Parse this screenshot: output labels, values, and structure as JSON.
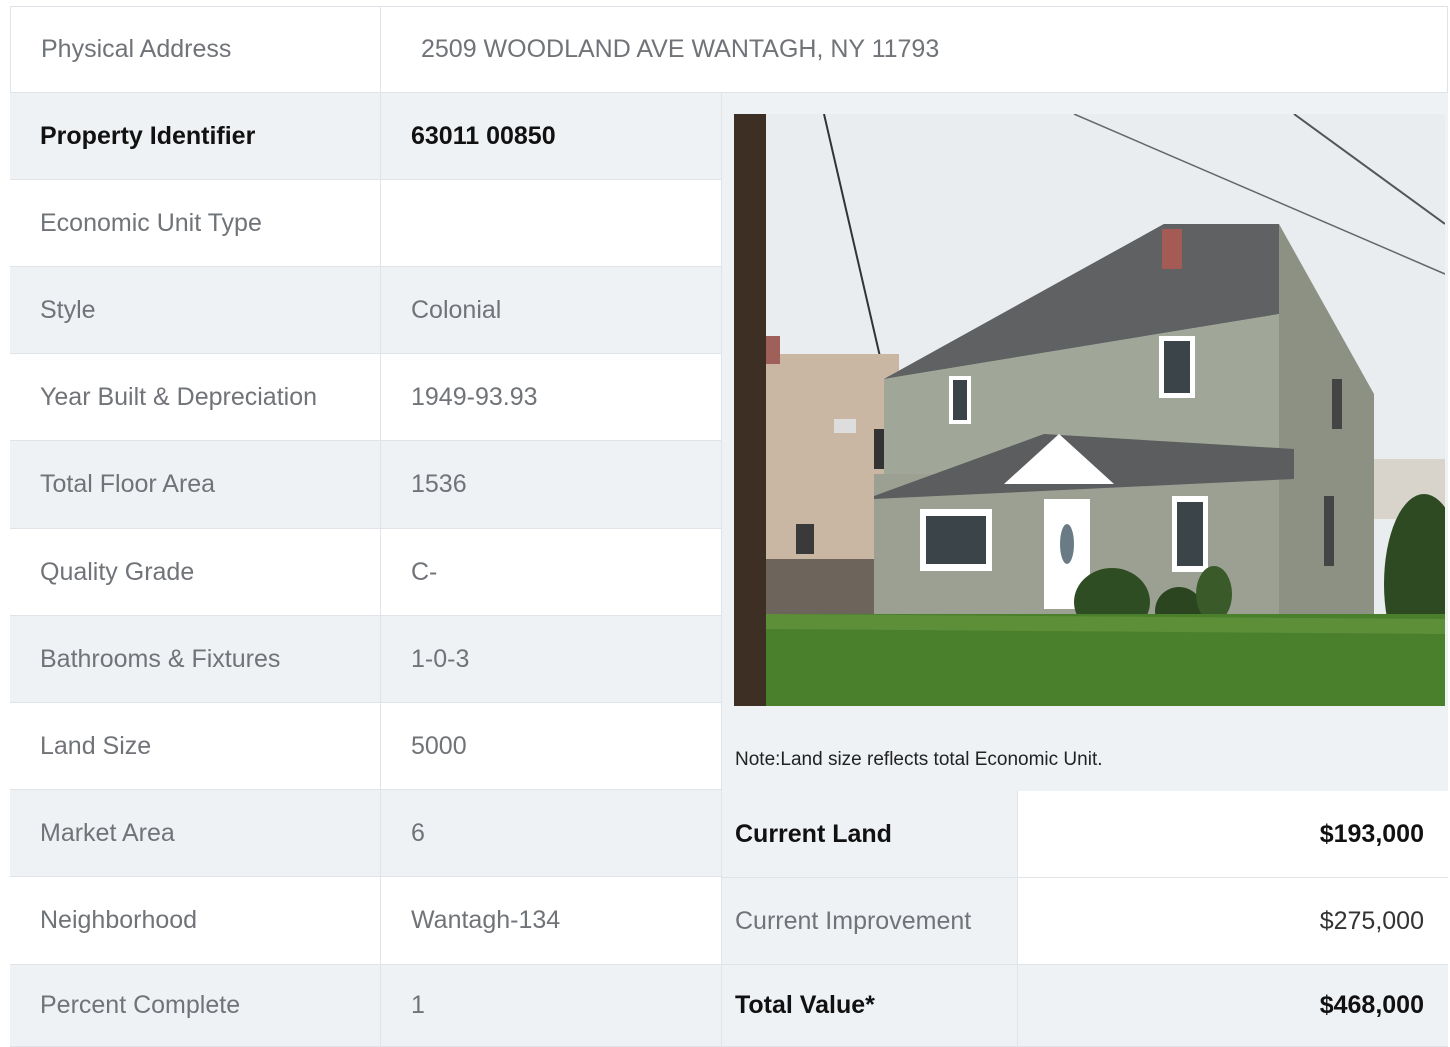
{
  "address": {
    "label": "Physical Address",
    "value": "2509  WOODLAND AVE  WANTAGH, NY  11793"
  },
  "rows": [
    {
      "label": "Property Identifier",
      "value": "63011  00850"
    },
    {
      "label": "Economic Unit Type",
      "value": ""
    },
    {
      "label": "Style",
      "value": "Colonial"
    },
    {
      "label": "Year Built & Depreciation",
      "value": "1949-93.93"
    },
    {
      "label": "Total Floor Area",
      "value": "1536"
    },
    {
      "label": "Quality Grade",
      "value": "C-"
    },
    {
      "label": "Bathrooms & Fixtures",
      "value": "1-0-3"
    },
    {
      "label": "Land Size",
      "value": "5000"
    },
    {
      "label": "Market Area",
      "value": "6"
    },
    {
      "label": "Neighborhood",
      "value": "Wantagh-134"
    },
    {
      "label": "Percent Complete",
      "value": "1"
    }
  ],
  "note": "Note:Land size reflects total Economic Unit.",
  "values": [
    {
      "label": "Current Land",
      "amount": "$193,000"
    },
    {
      "label": "Current Improvement",
      "amount": "$275,000"
    },
    {
      "label": "Total Value*",
      "amount": "$468,000"
    }
  ],
  "colors": {
    "shade": "#eff2f5",
    "label_text": "#707377",
    "border": "#e0e4e8"
  }
}
